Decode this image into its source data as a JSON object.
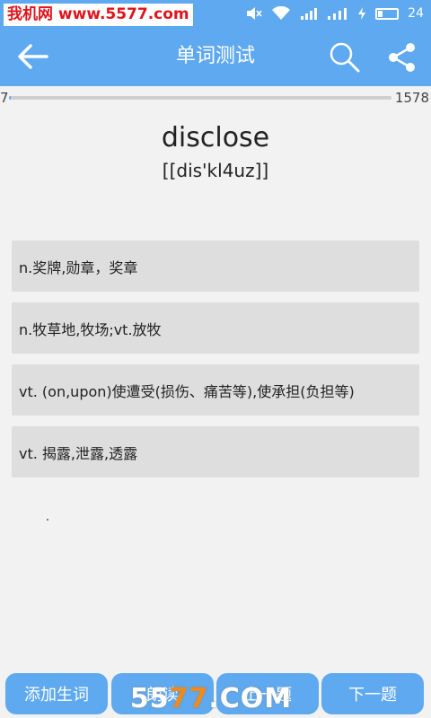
{
  "status_bar": {
    "watermark_text": "我机网 www.5577.com",
    "battery_level": "24",
    "battery_fill_fraction": 0.24
  },
  "app_bar": {
    "title": "单词测试",
    "icons": [
      "back-arrow-icon",
      "search-icon",
      "share-icon"
    ]
  },
  "progress": {
    "current": "7",
    "total": "1578",
    "fraction": 0.0044
  },
  "question": {
    "word": "disclose",
    "phonetic": "[[dis'kl4uz]]"
  },
  "options": [
    "n.奖牌,勋章，奖章",
    "n.牧草地,牧场;vt.放牧",
    "vt. (on,upon)使遭受(损伤、痛苦等),使承担(负担等)",
    "vt. 揭露,泄露,透露"
  ],
  "buttons": {
    "add_word": "添加生词",
    "btn2": "朗读",
    "btn3": "上一题",
    "next": "下一题"
  },
  "bottom_watermark": {
    "prefix": "55",
    "accent": "77",
    "suffix": ".COM"
  },
  "colors": {
    "primary": "#5ea9ef",
    "option_bg": "#dedede",
    "background": "#f2f2f2",
    "watermark_red": "#e0141c"
  }
}
